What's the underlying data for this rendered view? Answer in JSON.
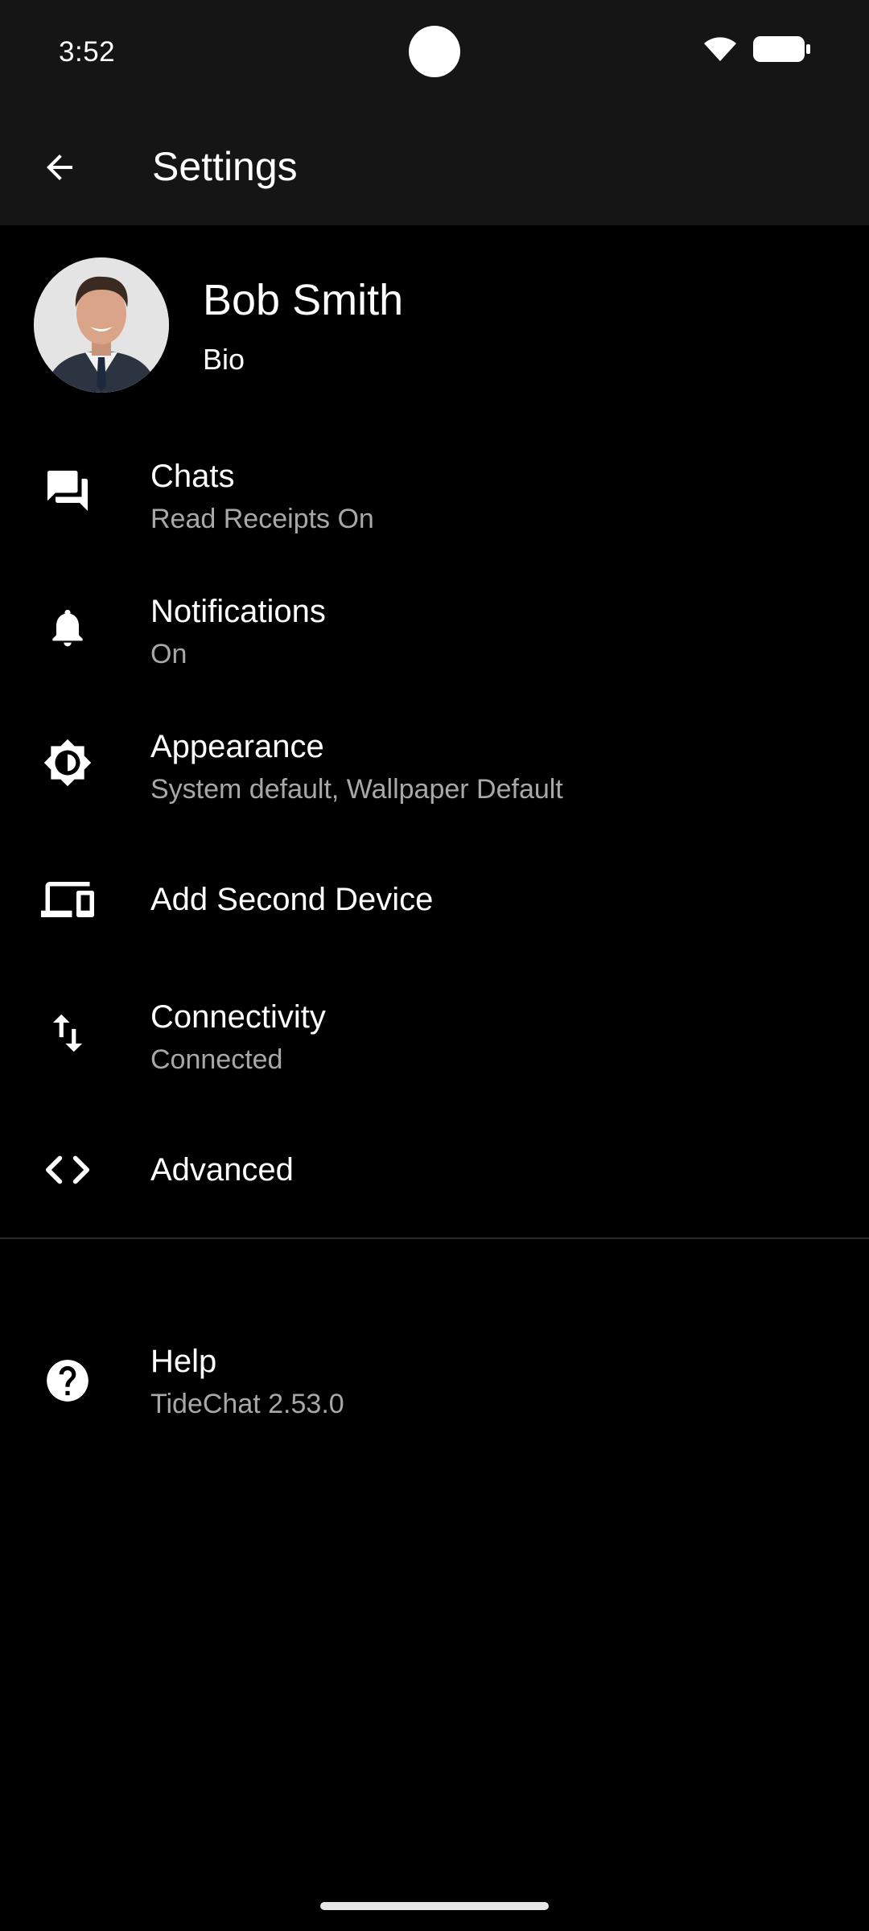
{
  "status_bar": {
    "time": "3:52"
  },
  "app_bar": {
    "title": "Settings"
  },
  "profile": {
    "name": "Bob Smith",
    "bio": "Bio"
  },
  "settings": [
    {
      "id": "chats",
      "icon": "chat-bubbles-icon",
      "title": "Chats",
      "subtitle": "Read Receipts On"
    },
    {
      "id": "notifications",
      "icon": "bell-icon",
      "title": "Notifications",
      "subtitle": "On"
    },
    {
      "id": "appearance",
      "icon": "brightness-icon",
      "title": "Appearance",
      "subtitle": "System default, Wallpaper Default"
    },
    {
      "id": "second-device",
      "icon": "devices-icon",
      "title": "Add Second Device"
    },
    {
      "id": "connectivity",
      "icon": "swap-vertical-icon",
      "title": "Connectivity",
      "subtitle": "Connected"
    },
    {
      "id": "advanced",
      "icon": "code-icon",
      "title": "Advanced"
    },
    {
      "id": "help",
      "icon": "help-circle-icon",
      "title": "Help",
      "subtitle": "TideChat 2.53.0"
    }
  ]
}
